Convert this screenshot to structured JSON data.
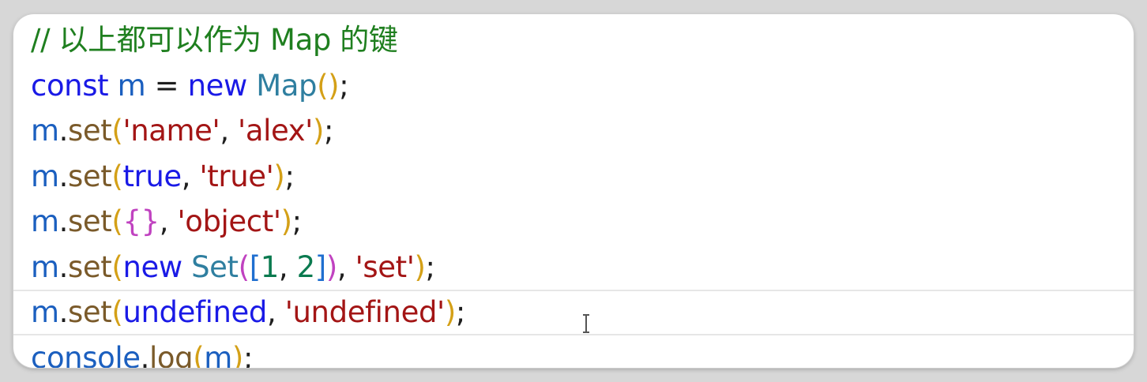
{
  "editor": {
    "theme": {
      "comment": "#1f7f1f",
      "keyword": "#1a1ae6",
      "variable": "#1b5fbf",
      "class": "#2f7fa0",
      "function": "#7a5a2a",
      "string": "#a31515",
      "number": "#0a7a4f",
      "punct": "#1e1e1e",
      "bracket1": "#d4a017",
      "bracket2": "#c042c0",
      "bracket3": "#1f6fd0"
    },
    "lines": [
      [
        {
          "t": "// 以上都可以作为 Map 的键",
          "k": "comment"
        }
      ],
      [
        {
          "t": "const",
          "k": "keyword"
        },
        {
          "t": " ",
          "k": "punct"
        },
        {
          "t": "m",
          "k": "variable"
        },
        {
          "t": " = ",
          "k": "punct"
        },
        {
          "t": "new",
          "k": "keyword"
        },
        {
          "t": " ",
          "k": "punct"
        },
        {
          "t": "Map",
          "k": "class"
        },
        {
          "t": "()",
          "k": "bracket1"
        },
        {
          "t": ";",
          "k": "punct"
        }
      ],
      [
        {
          "t": "m",
          "k": "variable"
        },
        {
          "t": ".",
          "k": "punct"
        },
        {
          "t": "set",
          "k": "function"
        },
        {
          "t": "(",
          "k": "bracket1"
        },
        {
          "t": "'name'",
          "k": "string"
        },
        {
          "t": ", ",
          "k": "punct"
        },
        {
          "t": "'alex'",
          "k": "string"
        },
        {
          "t": ")",
          "k": "bracket1"
        },
        {
          "t": ";",
          "k": "punct"
        }
      ],
      [
        {
          "t": "m",
          "k": "variable"
        },
        {
          "t": ".",
          "k": "punct"
        },
        {
          "t": "set",
          "k": "function"
        },
        {
          "t": "(",
          "k": "bracket1"
        },
        {
          "t": "true",
          "k": "keyword"
        },
        {
          "t": ", ",
          "k": "punct"
        },
        {
          "t": "'true'",
          "k": "string"
        },
        {
          "t": ")",
          "k": "bracket1"
        },
        {
          "t": ";",
          "k": "punct"
        }
      ],
      [
        {
          "t": "m",
          "k": "variable"
        },
        {
          "t": ".",
          "k": "punct"
        },
        {
          "t": "set",
          "k": "function"
        },
        {
          "t": "(",
          "k": "bracket1"
        },
        {
          "t": "{}",
          "k": "bracket2"
        },
        {
          "t": ", ",
          "k": "punct"
        },
        {
          "t": "'object'",
          "k": "string"
        },
        {
          "t": ")",
          "k": "bracket1"
        },
        {
          "t": ";",
          "k": "punct"
        }
      ],
      [
        {
          "t": "m",
          "k": "variable"
        },
        {
          "t": ".",
          "k": "punct"
        },
        {
          "t": "set",
          "k": "function"
        },
        {
          "t": "(",
          "k": "bracket1"
        },
        {
          "t": "new",
          "k": "keyword"
        },
        {
          "t": " ",
          "k": "punct"
        },
        {
          "t": "Set",
          "k": "class"
        },
        {
          "t": "(",
          "k": "bracket2"
        },
        {
          "t": "[",
          "k": "bracket3"
        },
        {
          "t": "1",
          "k": "number"
        },
        {
          "t": ", ",
          "k": "punct"
        },
        {
          "t": "2",
          "k": "number"
        },
        {
          "t": "]",
          "k": "bracket3"
        },
        {
          "t": ")",
          "k": "bracket2"
        },
        {
          "t": ", ",
          "k": "punct"
        },
        {
          "t": "'set'",
          "k": "string"
        },
        {
          "t": ")",
          "k": "bracket1"
        },
        {
          "t": ";",
          "k": "punct"
        }
      ],
      [
        {
          "t": "m",
          "k": "variable"
        },
        {
          "t": ".",
          "k": "punct"
        },
        {
          "t": "set",
          "k": "function"
        },
        {
          "t": "(",
          "k": "bracket1"
        },
        {
          "t": "undefined",
          "k": "keyword"
        },
        {
          "t": ", ",
          "k": "punct"
        },
        {
          "t": "'undefined'",
          "k": "string"
        },
        {
          "t": ")",
          "k": "bracket1"
        },
        {
          "t": ";",
          "k": "punct"
        }
      ],
      [
        {
          "t": "console",
          "k": "variable"
        },
        {
          "t": ".",
          "k": "punct"
        },
        {
          "t": "log",
          "k": "function"
        },
        {
          "t": "(",
          "k": "bracket1"
        },
        {
          "t": "m",
          "k": "variable"
        },
        {
          "t": ")",
          "k": "bracket1"
        },
        {
          "t": ";",
          "k": "punct"
        }
      ]
    ],
    "current_line": 6
  }
}
